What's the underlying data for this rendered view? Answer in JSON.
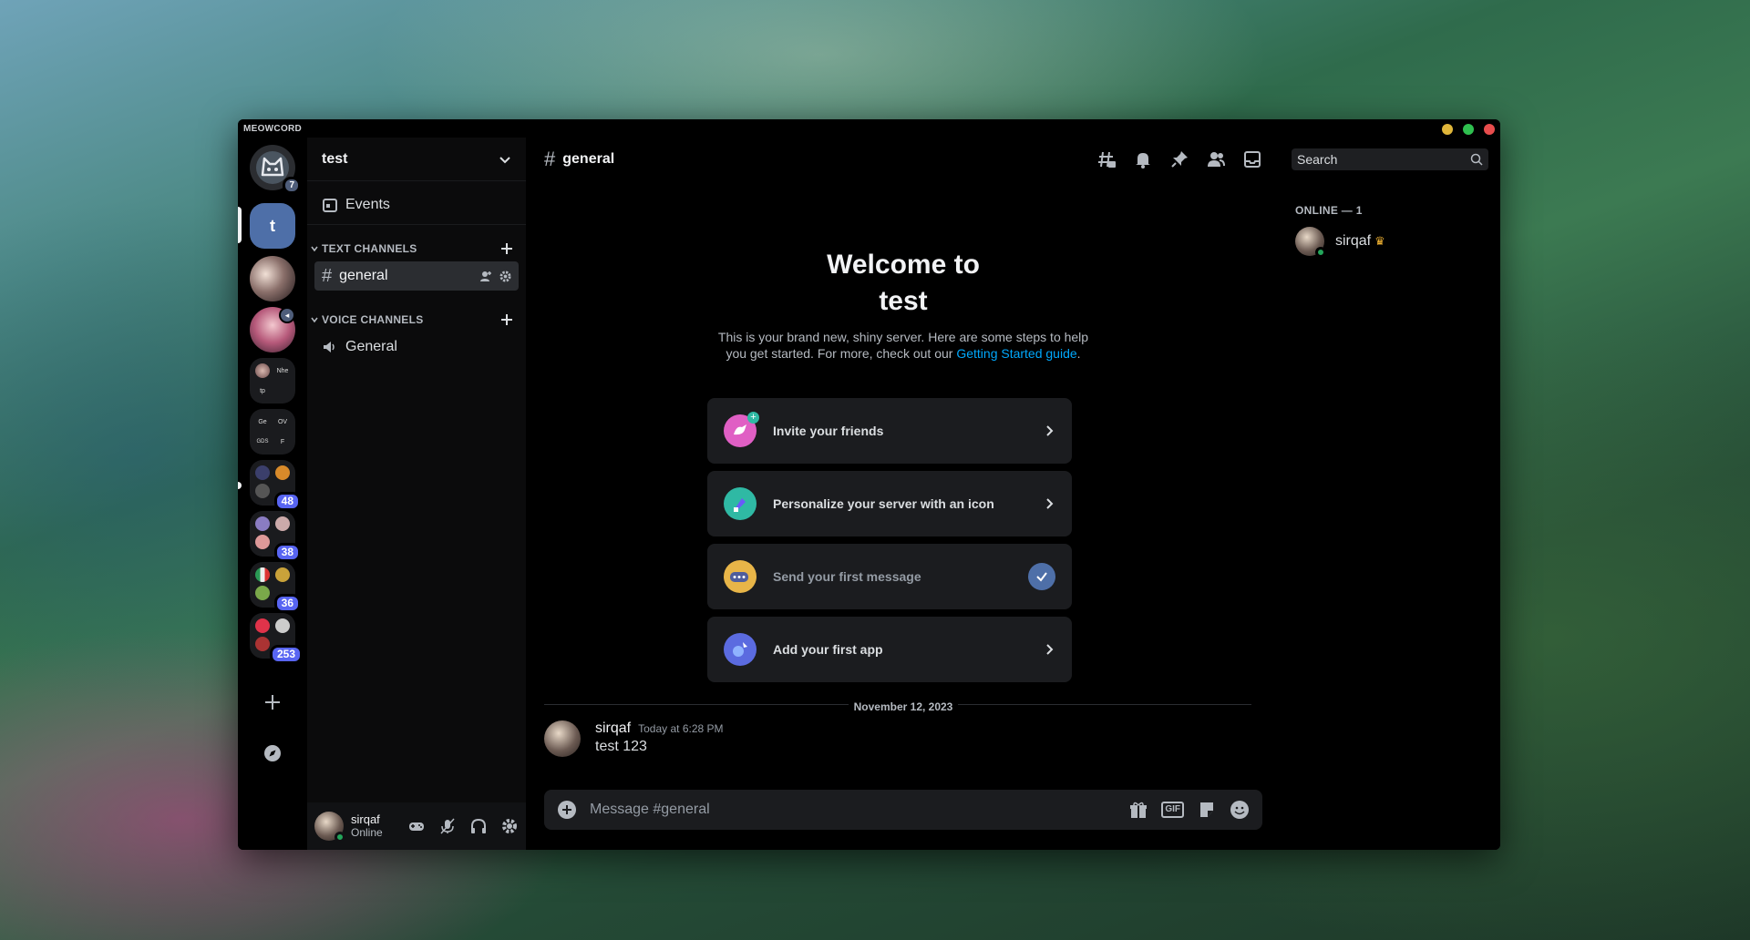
{
  "app": {
    "brand": "MEOWCORD"
  },
  "window_controls": [
    "minimize",
    "maximize",
    "close"
  ],
  "colors": {
    "accent": "#5865f2",
    "online": "#23a55a",
    "link": "#00a8fc",
    "check": "#4e6fa8",
    "crown": "#f0b232",
    "traffic_min": "#e0b63a",
    "traffic_max": "#2fbf4f",
    "traffic_close": "#e84d4d"
  },
  "rail": {
    "home_badge": "7",
    "active_server_initial": "t",
    "folders": [
      {
        "mini": [
          "",
          "Nhe",
          "tp",
          ""
        ]
      },
      {
        "mini": [
          "Ge",
          "OV",
          "GDS",
          "F"
        ]
      }
    ],
    "badges": [
      "48",
      "38",
      "36",
      "253"
    ]
  },
  "server": {
    "name": "test",
    "events_label": "Events",
    "categories": [
      {
        "label": "TEXT CHANNELS",
        "channels": [
          {
            "name": "general",
            "type": "text",
            "active": true
          }
        ]
      },
      {
        "label": "VOICE CHANNELS",
        "channels": [
          {
            "name": "General",
            "type": "voice",
            "active": false
          }
        ]
      }
    ]
  },
  "user": {
    "name": "sirqaf",
    "status": "Online"
  },
  "chat": {
    "channel": "general",
    "welcome_title_line1": "Welcome to",
    "welcome_title_line2": "test",
    "welcome_sub_before": "This is your brand new, shiny server. Here are some steps to help you get started. For more, check out our ",
    "welcome_sub_link": "Getting Started guide",
    "welcome_sub_after": ".",
    "cards": [
      {
        "label": "Invite your friends",
        "done": false,
        "icon": "invite-friends-icon"
      },
      {
        "label": "Personalize your server with an icon",
        "done": false,
        "icon": "personalize-icon"
      },
      {
        "label": "Send your first message",
        "done": true,
        "icon": "send-message-icon"
      },
      {
        "label": "Add your first app",
        "done": false,
        "icon": "add-app-icon"
      }
    ],
    "date_divider": "November 12, 2023",
    "message": {
      "author": "sirqaf",
      "time": "Today at 6:28 PM",
      "text": "test 123"
    },
    "composer_placeholder": "Message #general",
    "composer_gif": "GIF"
  },
  "members": {
    "search_placeholder": "Search",
    "category": "ONLINE — 1",
    "list": [
      {
        "name": "sirqaf",
        "owner": true
      }
    ]
  }
}
